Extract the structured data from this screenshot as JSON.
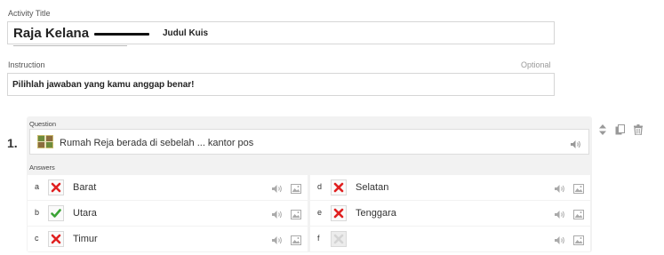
{
  "activity": {
    "title_label": "Activity Title",
    "title_value": "Raja Kelana",
    "title_annotation": "Judul Kuis"
  },
  "instruction": {
    "label": "Instruction",
    "optional_label": "Optional",
    "value": "Pilihlah jawaban yang kamu anggap benar!"
  },
  "question": {
    "number": "1.",
    "label": "Question",
    "text": "Rumah Reja berada di sebelah ... kantor pos"
  },
  "answers": {
    "label": "Answers",
    "items": [
      {
        "letter": "a",
        "text": "Barat",
        "state": "wrong"
      },
      {
        "letter": "b",
        "text": "Utara",
        "state": "correct"
      },
      {
        "letter": "c",
        "text": "Timur",
        "state": "wrong"
      },
      {
        "letter": "d",
        "text": "Selatan",
        "state": "wrong"
      },
      {
        "letter": "e",
        "text": "Tenggara",
        "state": "wrong"
      },
      {
        "letter": "f",
        "text": "",
        "state": "empty"
      }
    ]
  },
  "icons": {
    "speaker": "speaker-icon",
    "image": "image-icon",
    "reorder": "reorder-icon",
    "duplicate": "duplicate-icon",
    "delete": "trash-icon"
  },
  "colors": {
    "wrong": "#e02020",
    "correct": "#3aa335",
    "panel": "#f2f2f2",
    "border": "#d6d6d6"
  }
}
